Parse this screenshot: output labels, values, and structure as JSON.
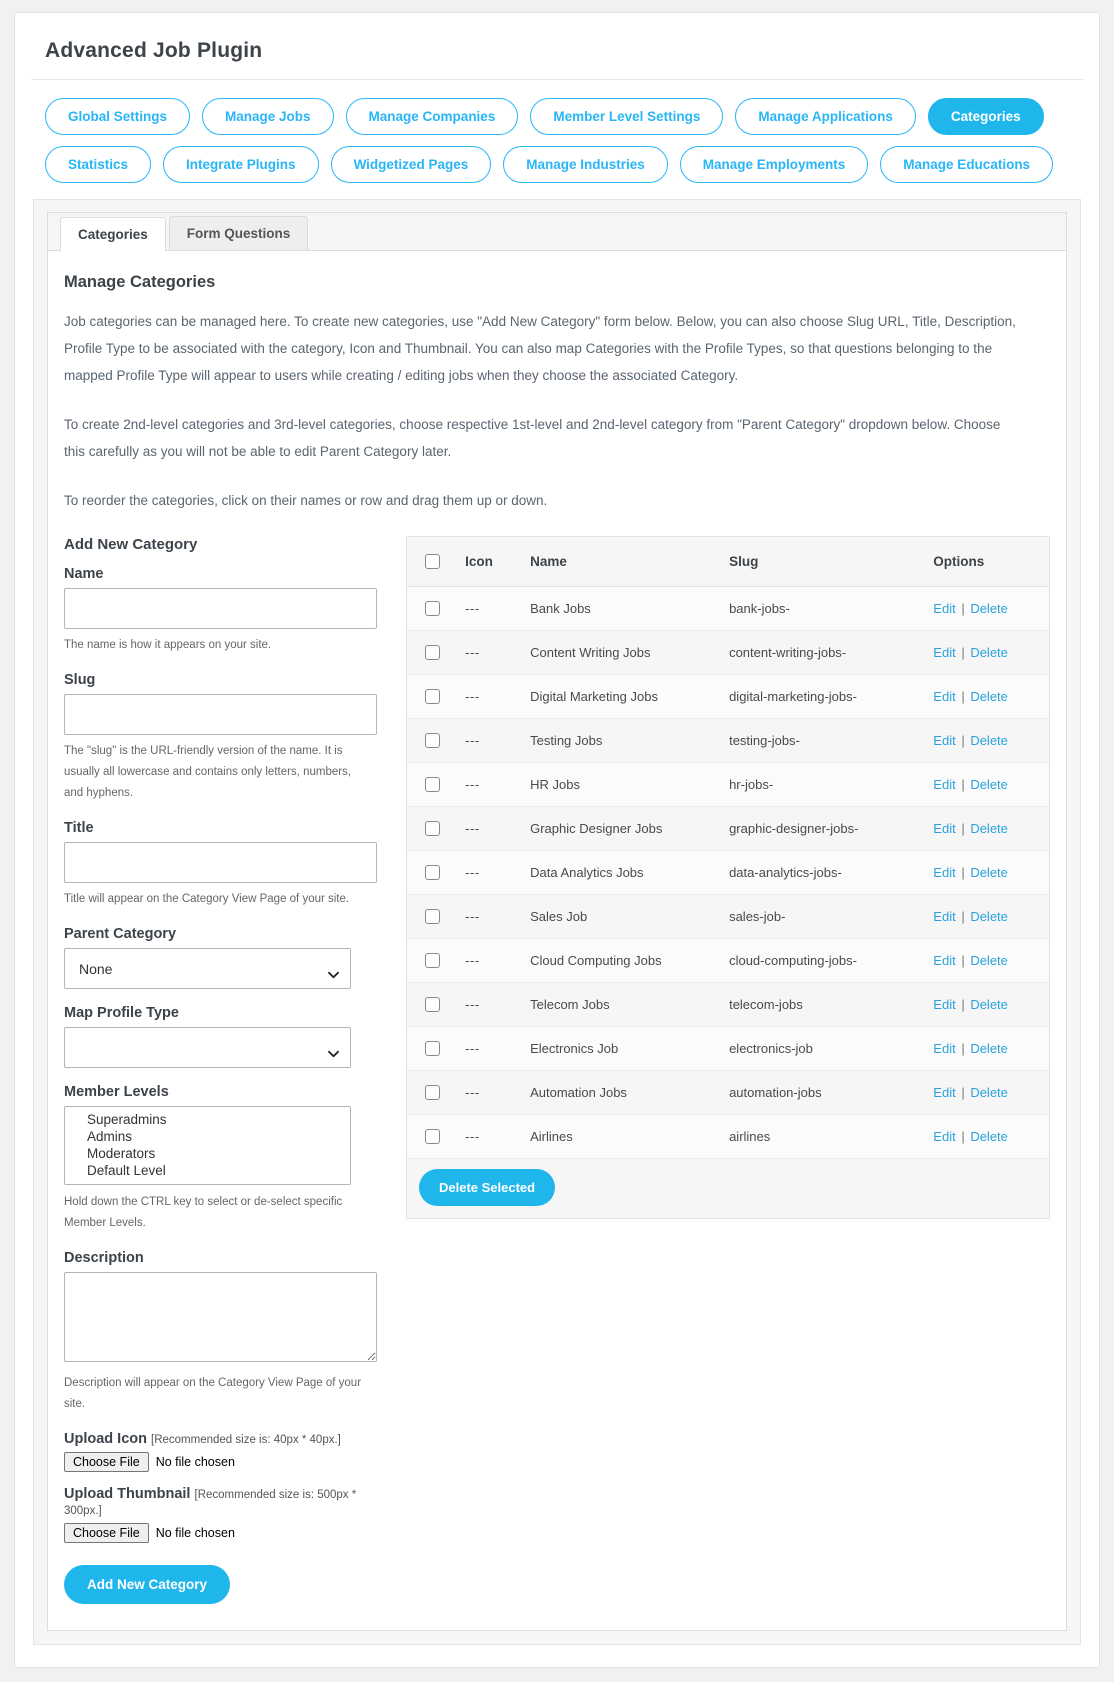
{
  "header": {
    "title": "Advanced Job Plugin"
  },
  "nav": {
    "rows": [
      [
        {
          "label": "Global Settings",
          "active": false
        },
        {
          "label": "Manage Jobs",
          "active": false
        },
        {
          "label": "Manage Companies",
          "active": false
        },
        {
          "label": "Member Level Settings",
          "active": false
        },
        {
          "label": "Manage Applications",
          "active": false
        },
        {
          "label": "Categories",
          "active": true
        }
      ],
      [
        {
          "label": "Statistics",
          "active": false
        },
        {
          "label": "Integrate Plugins",
          "active": false
        },
        {
          "label": "Widgetized Pages",
          "active": false
        },
        {
          "label": "Manage Industries",
          "active": false
        },
        {
          "label": "Manage Employments",
          "active": false
        },
        {
          "label": "Manage Educations",
          "active": false
        }
      ]
    ],
    "accent_color": "#1fb6ec"
  },
  "tabs": [
    {
      "label": "Categories",
      "active": true
    },
    {
      "label": "Form Questions",
      "active": false
    }
  ],
  "main": {
    "section_title": "Manage Categories",
    "paragraphs": [
      "Job categories can be managed here. To create new categories, use \"Add New Category\" form below. Below, you can also choose Slug URL, Title, Description, Profile Type to be associated with the category, Icon and Thumbnail. You can also map Categories with the Profile Types, so that questions belonging to the mapped Profile Type will appear to users while creating / editing jobs when they choose the associated Category.",
      "To create 2nd-level categories and 3rd-level categories, choose respective 1st-level and 2nd-level category from \"Parent Category\" dropdown below. Choose this carefully as you will not be able to edit Parent Category later.",
      "To reorder the categories, click on their names or row and drag them up or down."
    ]
  },
  "form": {
    "title": "Add New Category",
    "name": {
      "label": "Name",
      "value": "",
      "placeholder": "",
      "hint": "The name is how it appears on your site."
    },
    "slug": {
      "label": "Slug",
      "value": "",
      "placeholder": "",
      "hint": "The \"slug\" is the URL-friendly version of the name. It is usually all lowercase and contains only letters, numbers, and hyphens."
    },
    "title_field": {
      "label": "Title",
      "value": "",
      "placeholder": "",
      "hint": "Title will appear on the Category View Page of your site."
    },
    "parent_category": {
      "label": "Parent Category",
      "selected": "None",
      "options": [
        "None"
      ]
    },
    "map_profile_type": {
      "label": "Map Profile Type",
      "selected": "",
      "options": [
        ""
      ]
    },
    "member_levels": {
      "label": "Member Levels",
      "options": [
        "Superadmins",
        "Admins",
        "Moderators",
        "Default Level"
      ],
      "hint": "Hold down the CTRL key to select or de-select specific Member Levels."
    },
    "description": {
      "label": "Description",
      "value": "",
      "hint": "Description will appear on the Category View Page of your site."
    },
    "upload_icon": {
      "label": "Upload Icon",
      "note": "[Recommended size is: 40px * 40px.]",
      "button": "Choose File",
      "file_status": "No file chosen"
    },
    "upload_thumbnail": {
      "label": "Upload Thumbnail",
      "note": "[Recommended size is: 500px * 300px.]",
      "button": "Choose File",
      "file_status": "No file chosen"
    },
    "submit_label": "Add New Category"
  },
  "table": {
    "headers": [
      "",
      "Icon",
      "Name",
      "Slug",
      "Options"
    ],
    "icon_placeholder": "---",
    "edit_label": "Edit",
    "separator": "|",
    "delete_label": "Delete",
    "rows": [
      {
        "icon": "---",
        "name": "Bank Jobs",
        "slug": "bank-jobs-"
      },
      {
        "icon": "---",
        "name": "Content Writing Jobs",
        "slug": "content-writing-jobs-"
      },
      {
        "icon": "---",
        "name": "Digital Marketing Jobs",
        "slug": "digital-marketing-jobs-"
      },
      {
        "icon": "---",
        "name": "Testing Jobs",
        "slug": "testing-jobs-"
      },
      {
        "icon": "---",
        "name": "HR Jobs",
        "slug": "hr-jobs-"
      },
      {
        "icon": "---",
        "name": "Graphic Designer Jobs",
        "slug": "graphic-designer-jobs-"
      },
      {
        "icon": "---",
        "name": "Data Analytics Jobs",
        "slug": "data-analytics-jobs-"
      },
      {
        "icon": "---",
        "name": "Sales Job",
        "slug": "sales-job-"
      },
      {
        "icon": "---",
        "name": "Cloud Computing Jobs",
        "slug": "cloud-computing-jobs-"
      },
      {
        "icon": "---",
        "name": "Telecom Jobs",
        "slug": "telecom-jobs"
      },
      {
        "icon": "---",
        "name": "Electronics Job",
        "slug": "electronics-job"
      },
      {
        "icon": "---",
        "name": "Automation Jobs",
        "slug": "automation-jobs"
      },
      {
        "icon": "---",
        "name": "Airlines",
        "slug": "airlines"
      }
    ],
    "delete_selected_label": "Delete Selected"
  }
}
